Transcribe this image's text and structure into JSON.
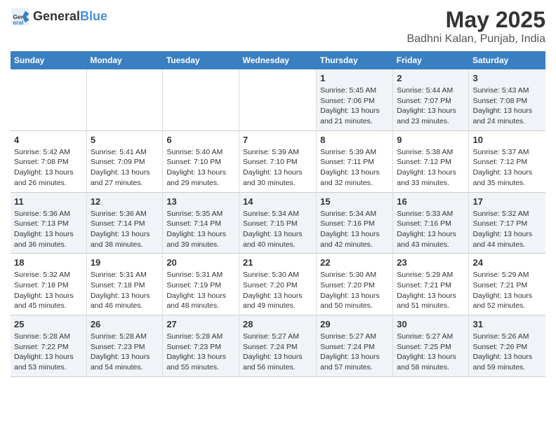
{
  "header": {
    "logo_general": "General",
    "logo_blue": "Blue",
    "month": "May 2025",
    "location": "Badhni Kalan, Punjab, India"
  },
  "days_of_week": [
    "Sunday",
    "Monday",
    "Tuesday",
    "Wednesday",
    "Thursday",
    "Friday",
    "Saturday"
  ],
  "weeks": [
    [
      {
        "day": "",
        "info": ""
      },
      {
        "day": "",
        "info": ""
      },
      {
        "day": "",
        "info": ""
      },
      {
        "day": "",
        "info": ""
      },
      {
        "day": "1",
        "info": "Sunrise: 5:45 AM\nSunset: 7:06 PM\nDaylight: 13 hours and 21 minutes."
      },
      {
        "day": "2",
        "info": "Sunrise: 5:44 AM\nSunset: 7:07 PM\nDaylight: 13 hours and 23 minutes."
      },
      {
        "day": "3",
        "info": "Sunrise: 5:43 AM\nSunset: 7:08 PM\nDaylight: 13 hours and 24 minutes."
      }
    ],
    [
      {
        "day": "4",
        "info": "Sunrise: 5:42 AM\nSunset: 7:08 PM\nDaylight: 13 hours and 26 minutes."
      },
      {
        "day": "5",
        "info": "Sunrise: 5:41 AM\nSunset: 7:09 PM\nDaylight: 13 hours and 27 minutes."
      },
      {
        "day": "6",
        "info": "Sunrise: 5:40 AM\nSunset: 7:10 PM\nDaylight: 13 hours and 29 minutes."
      },
      {
        "day": "7",
        "info": "Sunrise: 5:39 AM\nSunset: 7:10 PM\nDaylight: 13 hours and 30 minutes."
      },
      {
        "day": "8",
        "info": "Sunrise: 5:39 AM\nSunset: 7:11 PM\nDaylight: 13 hours and 32 minutes."
      },
      {
        "day": "9",
        "info": "Sunrise: 5:38 AM\nSunset: 7:12 PM\nDaylight: 13 hours and 33 minutes."
      },
      {
        "day": "10",
        "info": "Sunrise: 5:37 AM\nSunset: 7:12 PM\nDaylight: 13 hours and 35 minutes."
      }
    ],
    [
      {
        "day": "11",
        "info": "Sunrise: 5:36 AM\nSunset: 7:13 PM\nDaylight: 13 hours and 36 minutes."
      },
      {
        "day": "12",
        "info": "Sunrise: 5:36 AM\nSunset: 7:14 PM\nDaylight: 13 hours and 38 minutes."
      },
      {
        "day": "13",
        "info": "Sunrise: 5:35 AM\nSunset: 7:14 PM\nDaylight: 13 hours and 39 minutes."
      },
      {
        "day": "14",
        "info": "Sunrise: 5:34 AM\nSunset: 7:15 PM\nDaylight: 13 hours and 40 minutes."
      },
      {
        "day": "15",
        "info": "Sunrise: 5:34 AM\nSunset: 7:16 PM\nDaylight: 13 hours and 42 minutes."
      },
      {
        "day": "16",
        "info": "Sunrise: 5:33 AM\nSunset: 7:16 PM\nDaylight: 13 hours and 43 minutes."
      },
      {
        "day": "17",
        "info": "Sunrise: 5:32 AM\nSunset: 7:17 PM\nDaylight: 13 hours and 44 minutes."
      }
    ],
    [
      {
        "day": "18",
        "info": "Sunrise: 5:32 AM\nSunset: 7:18 PM\nDaylight: 13 hours and 45 minutes."
      },
      {
        "day": "19",
        "info": "Sunrise: 5:31 AM\nSunset: 7:18 PM\nDaylight: 13 hours and 46 minutes."
      },
      {
        "day": "20",
        "info": "Sunrise: 5:31 AM\nSunset: 7:19 PM\nDaylight: 13 hours and 48 minutes."
      },
      {
        "day": "21",
        "info": "Sunrise: 5:30 AM\nSunset: 7:20 PM\nDaylight: 13 hours and 49 minutes."
      },
      {
        "day": "22",
        "info": "Sunrise: 5:30 AM\nSunset: 7:20 PM\nDaylight: 13 hours and 50 minutes."
      },
      {
        "day": "23",
        "info": "Sunrise: 5:29 AM\nSunset: 7:21 PM\nDaylight: 13 hours and 51 minutes."
      },
      {
        "day": "24",
        "info": "Sunrise: 5:29 AM\nSunset: 7:21 PM\nDaylight: 13 hours and 52 minutes."
      }
    ],
    [
      {
        "day": "25",
        "info": "Sunrise: 5:28 AM\nSunset: 7:22 PM\nDaylight: 13 hours and 53 minutes."
      },
      {
        "day": "26",
        "info": "Sunrise: 5:28 AM\nSunset: 7:23 PM\nDaylight: 13 hours and 54 minutes."
      },
      {
        "day": "27",
        "info": "Sunrise: 5:28 AM\nSunset: 7:23 PM\nDaylight: 13 hours and 55 minutes."
      },
      {
        "day": "28",
        "info": "Sunrise: 5:27 AM\nSunset: 7:24 PM\nDaylight: 13 hours and 56 minutes."
      },
      {
        "day": "29",
        "info": "Sunrise: 5:27 AM\nSunset: 7:24 PM\nDaylight: 13 hours and 57 minutes."
      },
      {
        "day": "30",
        "info": "Sunrise: 5:27 AM\nSunset: 7:25 PM\nDaylight: 13 hours and 58 minutes."
      },
      {
        "day": "31",
        "info": "Sunrise: 5:26 AM\nSunset: 7:26 PM\nDaylight: 13 hours and 59 minutes."
      }
    ]
  ]
}
